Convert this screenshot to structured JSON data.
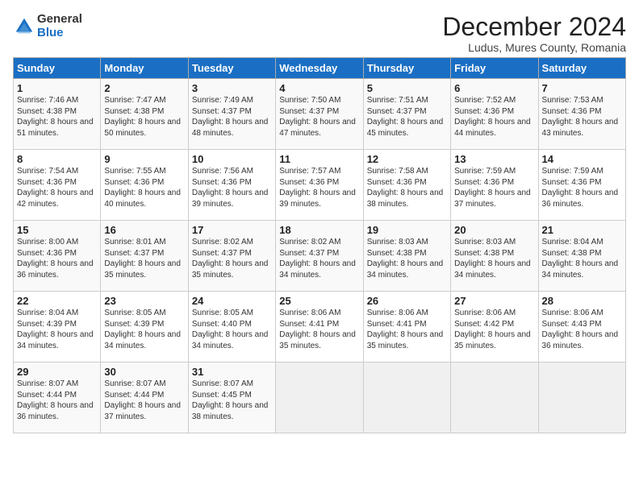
{
  "logo": {
    "general": "General",
    "blue": "Blue"
  },
  "title": "December 2024",
  "location": "Ludus, Mures County, Romania",
  "days_of_week": [
    "Sunday",
    "Monday",
    "Tuesday",
    "Wednesday",
    "Thursday",
    "Friday",
    "Saturday"
  ],
  "weeks": [
    [
      {
        "day": "1",
        "sunrise": "Sunrise: 7:46 AM",
        "sunset": "Sunset: 4:38 PM",
        "daylight": "Daylight: 8 hours and 51 minutes."
      },
      {
        "day": "2",
        "sunrise": "Sunrise: 7:47 AM",
        "sunset": "Sunset: 4:38 PM",
        "daylight": "Daylight: 8 hours and 50 minutes."
      },
      {
        "day": "3",
        "sunrise": "Sunrise: 7:49 AM",
        "sunset": "Sunset: 4:37 PM",
        "daylight": "Daylight: 8 hours and 48 minutes."
      },
      {
        "day": "4",
        "sunrise": "Sunrise: 7:50 AM",
        "sunset": "Sunset: 4:37 PM",
        "daylight": "Daylight: 8 hours and 47 minutes."
      },
      {
        "day": "5",
        "sunrise": "Sunrise: 7:51 AM",
        "sunset": "Sunset: 4:37 PM",
        "daylight": "Daylight: 8 hours and 45 minutes."
      },
      {
        "day": "6",
        "sunrise": "Sunrise: 7:52 AM",
        "sunset": "Sunset: 4:36 PM",
        "daylight": "Daylight: 8 hours and 44 minutes."
      },
      {
        "day": "7",
        "sunrise": "Sunrise: 7:53 AM",
        "sunset": "Sunset: 4:36 PM",
        "daylight": "Daylight: 8 hours and 43 minutes."
      }
    ],
    [
      {
        "day": "8",
        "sunrise": "Sunrise: 7:54 AM",
        "sunset": "Sunset: 4:36 PM",
        "daylight": "Daylight: 8 hours and 42 minutes."
      },
      {
        "day": "9",
        "sunrise": "Sunrise: 7:55 AM",
        "sunset": "Sunset: 4:36 PM",
        "daylight": "Daylight: 8 hours and 40 minutes."
      },
      {
        "day": "10",
        "sunrise": "Sunrise: 7:56 AM",
        "sunset": "Sunset: 4:36 PM",
        "daylight": "Daylight: 8 hours and 39 minutes."
      },
      {
        "day": "11",
        "sunrise": "Sunrise: 7:57 AM",
        "sunset": "Sunset: 4:36 PM",
        "daylight": "Daylight: 8 hours and 39 minutes."
      },
      {
        "day": "12",
        "sunrise": "Sunrise: 7:58 AM",
        "sunset": "Sunset: 4:36 PM",
        "daylight": "Daylight: 8 hours and 38 minutes."
      },
      {
        "day": "13",
        "sunrise": "Sunrise: 7:59 AM",
        "sunset": "Sunset: 4:36 PM",
        "daylight": "Daylight: 8 hours and 37 minutes."
      },
      {
        "day": "14",
        "sunrise": "Sunrise: 7:59 AM",
        "sunset": "Sunset: 4:36 PM",
        "daylight": "Daylight: 8 hours and 36 minutes."
      }
    ],
    [
      {
        "day": "15",
        "sunrise": "Sunrise: 8:00 AM",
        "sunset": "Sunset: 4:36 PM",
        "daylight": "Daylight: 8 hours and 36 minutes."
      },
      {
        "day": "16",
        "sunrise": "Sunrise: 8:01 AM",
        "sunset": "Sunset: 4:37 PM",
        "daylight": "Daylight: 8 hours and 35 minutes."
      },
      {
        "day": "17",
        "sunrise": "Sunrise: 8:02 AM",
        "sunset": "Sunset: 4:37 PM",
        "daylight": "Daylight: 8 hours and 35 minutes."
      },
      {
        "day": "18",
        "sunrise": "Sunrise: 8:02 AM",
        "sunset": "Sunset: 4:37 PM",
        "daylight": "Daylight: 8 hours and 34 minutes."
      },
      {
        "day": "19",
        "sunrise": "Sunrise: 8:03 AM",
        "sunset": "Sunset: 4:38 PM",
        "daylight": "Daylight: 8 hours and 34 minutes."
      },
      {
        "day": "20",
        "sunrise": "Sunrise: 8:03 AM",
        "sunset": "Sunset: 4:38 PM",
        "daylight": "Daylight: 8 hours and 34 minutes."
      },
      {
        "day": "21",
        "sunrise": "Sunrise: 8:04 AM",
        "sunset": "Sunset: 4:38 PM",
        "daylight": "Daylight: 8 hours and 34 minutes."
      }
    ],
    [
      {
        "day": "22",
        "sunrise": "Sunrise: 8:04 AM",
        "sunset": "Sunset: 4:39 PM",
        "daylight": "Daylight: 8 hours and 34 minutes."
      },
      {
        "day": "23",
        "sunrise": "Sunrise: 8:05 AM",
        "sunset": "Sunset: 4:39 PM",
        "daylight": "Daylight: 8 hours and 34 minutes."
      },
      {
        "day": "24",
        "sunrise": "Sunrise: 8:05 AM",
        "sunset": "Sunset: 4:40 PM",
        "daylight": "Daylight: 8 hours and 34 minutes."
      },
      {
        "day": "25",
        "sunrise": "Sunrise: 8:06 AM",
        "sunset": "Sunset: 4:41 PM",
        "daylight": "Daylight: 8 hours and 35 minutes."
      },
      {
        "day": "26",
        "sunrise": "Sunrise: 8:06 AM",
        "sunset": "Sunset: 4:41 PM",
        "daylight": "Daylight: 8 hours and 35 minutes."
      },
      {
        "day": "27",
        "sunrise": "Sunrise: 8:06 AM",
        "sunset": "Sunset: 4:42 PM",
        "daylight": "Daylight: 8 hours and 35 minutes."
      },
      {
        "day": "28",
        "sunrise": "Sunrise: 8:06 AM",
        "sunset": "Sunset: 4:43 PM",
        "daylight": "Daylight: 8 hours and 36 minutes."
      }
    ],
    [
      {
        "day": "29",
        "sunrise": "Sunrise: 8:07 AM",
        "sunset": "Sunset: 4:44 PM",
        "daylight": "Daylight: 8 hours and 36 minutes."
      },
      {
        "day": "30",
        "sunrise": "Sunrise: 8:07 AM",
        "sunset": "Sunset: 4:44 PM",
        "daylight": "Daylight: 8 hours and 37 minutes."
      },
      {
        "day": "31",
        "sunrise": "Sunrise: 8:07 AM",
        "sunset": "Sunset: 4:45 PM",
        "daylight": "Daylight: 8 hours and 38 minutes."
      },
      null,
      null,
      null,
      null
    ]
  ]
}
